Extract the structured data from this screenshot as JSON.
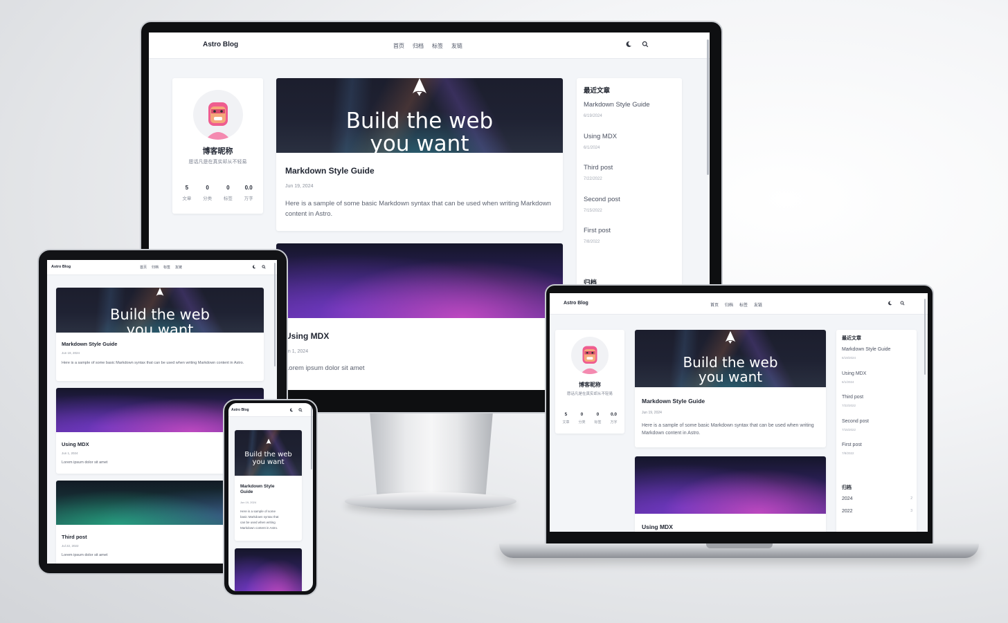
{
  "site": {
    "brand": "Astro Blog",
    "nav": [
      "首页",
      "归档",
      "标签",
      "友链"
    ],
    "theme_icon": "moon-icon",
    "search_icon": "search-icon"
  },
  "hero": {
    "line1": "Build the web",
    "line2": "you want"
  },
  "profile": {
    "name": "博客昵称",
    "motto": "愿话凡是在真实却从不轻易",
    "stats": [
      {
        "value": "5",
        "label": "文章"
      },
      {
        "value": "0",
        "label": "分类"
      },
      {
        "value": "0",
        "label": "标签"
      },
      {
        "value": "0.0",
        "label": "万字"
      }
    ]
  },
  "posts": [
    {
      "title": "Markdown Style Guide",
      "date": "Jun 19, 2024",
      "desc": "Here is a sample of some basic Markdown syntax that can be used when writing Markdown content in Astro."
    },
    {
      "title": "Using MDX",
      "date": "Jun 1, 2024",
      "desc": "Lorem ipsum dolor sit amet"
    },
    {
      "title": "Third post",
      "date": "Jul 22, 2022",
      "desc": "Lorem ipsum dolor sit amet"
    }
  ],
  "sidebar": {
    "recent_title": "最近文章",
    "recent": [
      {
        "title": "Markdown Style Guide",
        "date": "6/19/2024"
      },
      {
        "title": "Using MDX",
        "date": "6/1/2024"
      },
      {
        "title": "Third post",
        "date": "7/22/2022"
      },
      {
        "title": "Second post",
        "date": "7/15/2022"
      },
      {
        "title": "First post",
        "date": "7/8/2022"
      }
    ],
    "archive_title": "归档",
    "archive": [
      {
        "year": "2024",
        "count": "2"
      },
      {
        "year": "2022",
        "count": "3"
      }
    ]
  },
  "desktop_partial": {
    "second_post_title": "Using MDX",
    "second_post_date": "un 1, 2024",
    "second_post_desc": "Lorem ipsum dolor sit amet"
  },
  "phone_post_title": [
    "Markdown Style",
    "Guide"
  ],
  "phone_post_desc": [
    "Here is a sample of some",
    "basic Markdown syntax that",
    "can be used when writing",
    "Markdown content in Astro."
  ],
  "colors": {
    "hero_dark": "#1e2031",
    "accent_purple": "#7a3fc4",
    "screen_bg": "#f3f5f8",
    "bezel": "#111214"
  }
}
